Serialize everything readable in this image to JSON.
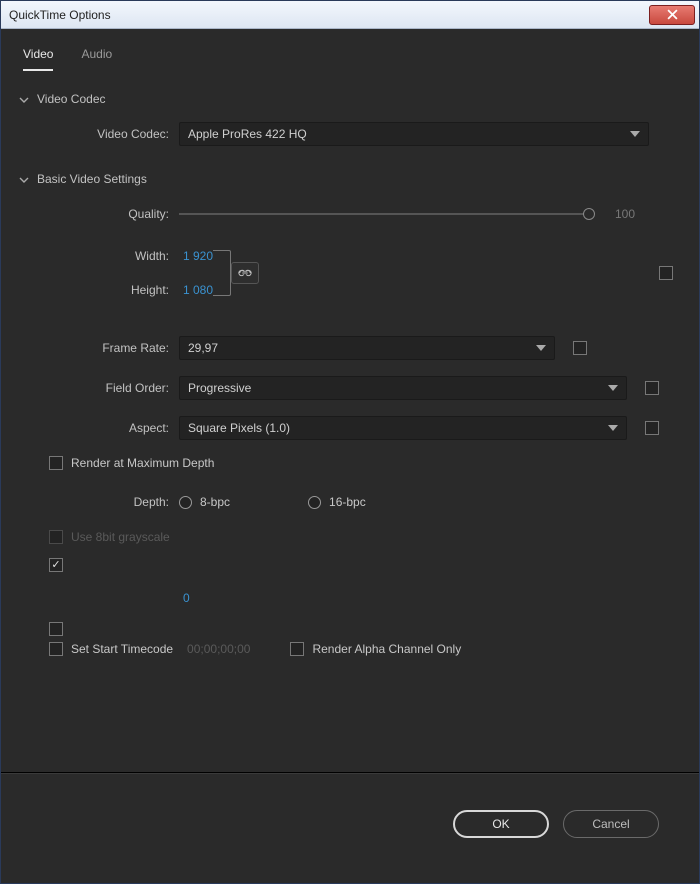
{
  "window": {
    "title": "QuickTime Options"
  },
  "tabs": {
    "video": "Video",
    "audio": "Audio"
  },
  "sections": {
    "codec": {
      "title": "Video Codec",
      "codec_label": "Video Codec:",
      "codec_value": "Apple ProRes 422 HQ"
    },
    "basic": {
      "title": "Basic Video Settings",
      "quality_label": "Quality:",
      "quality_value": "100",
      "width_label": "Width:",
      "width_value": "1 920",
      "height_label": "Height:",
      "height_value": "1 080",
      "framerate_label": "Frame Rate:",
      "framerate_value": "29,97",
      "fieldorder_label": "Field Order:",
      "fieldorder_value": "Progressive",
      "aspect_label": "Aspect:",
      "aspect_value": "Square Pixels (1.0)",
      "rendermax_label": "Render at Maximum Depth",
      "depth_label": "Depth:",
      "depth_8": "8-bpc",
      "depth_16": "16-bpc",
      "grayscale_label": "Use 8bit grayscale",
      "zero_value": "0",
      "settimecode_label": "Set Start Timecode",
      "settimecode_value": "00;00;00;00",
      "renderalpha_label": "Render Alpha Channel Only"
    }
  },
  "footer": {
    "ok": "OK",
    "cancel": "Cancel"
  }
}
